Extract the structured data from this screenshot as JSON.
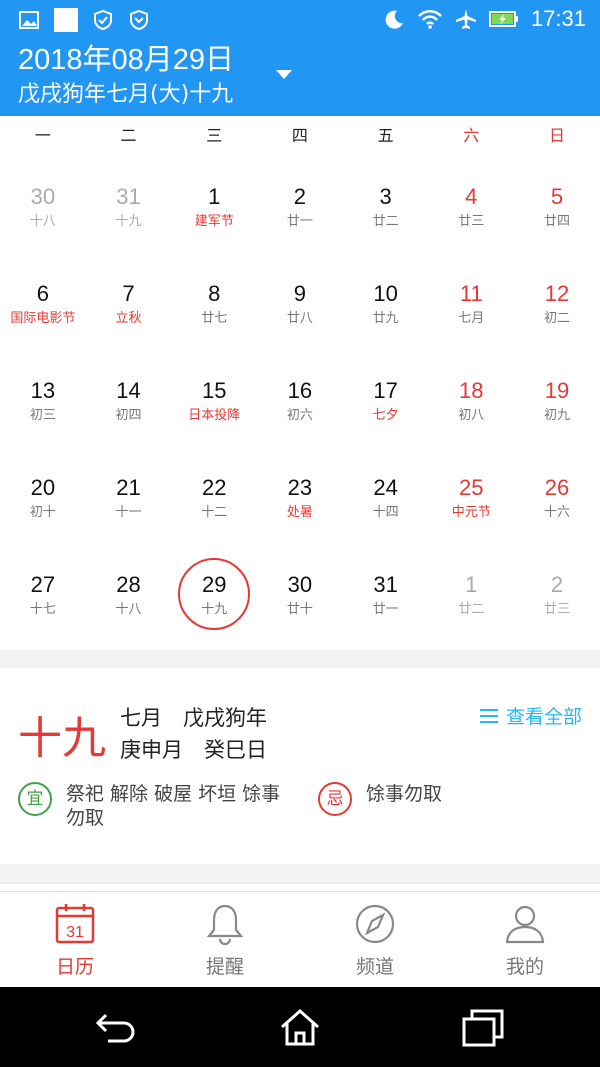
{
  "status": {
    "time": "17:31"
  },
  "header": {
    "date": "2018年08月29日",
    "lunar": "戊戌狗年七月(大)十九"
  },
  "weekdays": [
    "一",
    "二",
    "三",
    "四",
    "五",
    "六",
    "日"
  ],
  "weeks": [
    [
      {
        "d": "30",
        "l": "十八"
      },
      {
        "d": "31",
        "l": "十九"
      },
      {
        "d": "1",
        "l": "建军节"
      },
      {
        "d": "2",
        "l": "廿一"
      },
      {
        "d": "3",
        "l": "廿二"
      },
      {
        "d": "4",
        "l": "廿三"
      },
      {
        "d": "5",
        "l": "廿四"
      }
    ],
    [
      {
        "d": "6",
        "l": "国际电影节"
      },
      {
        "d": "7",
        "l": "立秋"
      },
      {
        "d": "8",
        "l": "廿七"
      },
      {
        "d": "9",
        "l": "廿八"
      },
      {
        "d": "10",
        "l": "廿九"
      },
      {
        "d": "11",
        "l": "七月"
      },
      {
        "d": "12",
        "l": "初二"
      }
    ],
    [
      {
        "d": "13",
        "l": "初三"
      },
      {
        "d": "14",
        "l": "初四"
      },
      {
        "d": "15",
        "l": "日本投降"
      },
      {
        "d": "16",
        "l": "初六"
      },
      {
        "d": "17",
        "l": "七夕"
      },
      {
        "d": "18",
        "l": "初八"
      },
      {
        "d": "19",
        "l": "初九"
      }
    ],
    [
      {
        "d": "20",
        "l": "初十"
      },
      {
        "d": "21",
        "l": "十一"
      },
      {
        "d": "22",
        "l": "十二"
      },
      {
        "d": "23",
        "l": "处暑"
      },
      {
        "d": "24",
        "l": "十四"
      },
      {
        "d": "25",
        "l": "中元节"
      },
      {
        "d": "26",
        "l": "十六"
      }
    ],
    [
      {
        "d": "27",
        "l": "十七"
      },
      {
        "d": "28",
        "l": "十八"
      },
      {
        "d": "29",
        "l": "十九"
      },
      {
        "d": "30",
        "l": "廿十"
      },
      {
        "d": "31",
        "l": "廿一"
      },
      {
        "d": "1",
        "l": "廿二"
      },
      {
        "d": "2",
        "l": "廿三"
      }
    ]
  ],
  "info": {
    "big_day": "十九",
    "line1": "七月　戊戌狗年",
    "line2": "庚申月　癸巳日",
    "view_all": "查看全部",
    "yi_label": "宜",
    "yi_text": "祭祀 解除 破屋 坏垣 馀事勿取",
    "ji_label": "忌",
    "ji_text": "馀事勿取"
  },
  "tabs": [
    {
      "label": "日历",
      "icon": "calendar-icon",
      "badge": "31"
    },
    {
      "label": "提醒",
      "icon": "bell-icon"
    },
    {
      "label": "频道",
      "icon": "compass-icon"
    },
    {
      "label": "我的",
      "icon": "user-icon"
    }
  ],
  "colors": {
    "primary": "#2196f3",
    "accent_red": "#e53935",
    "green": "#43a047",
    "link": "#29b6f6"
  }
}
